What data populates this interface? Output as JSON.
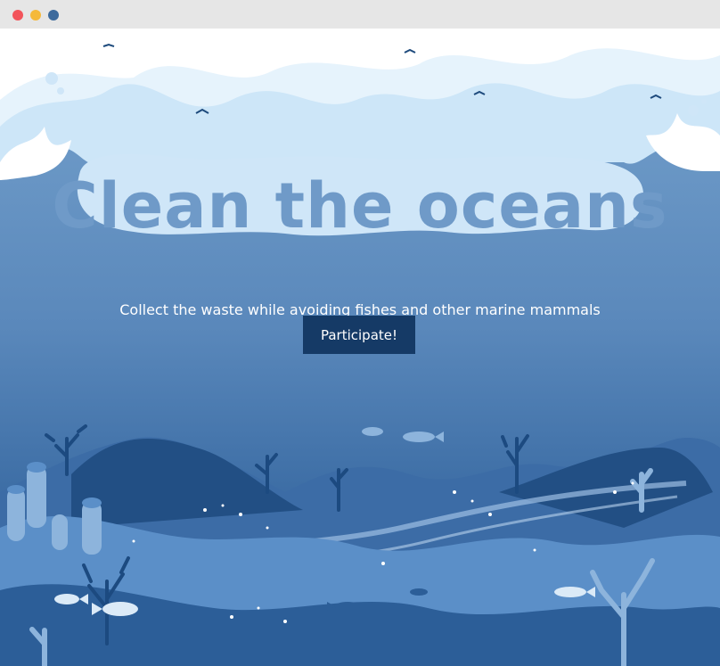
{
  "window": {
    "controls": [
      "close",
      "minimize",
      "maximize"
    ],
    "control_colors": {
      "close": "#f2545b",
      "minimize": "#f5b93a",
      "maximize": "#3d6a9c"
    }
  },
  "hero": {
    "title": "Clean the oceans",
    "subtitle": "Collect the waste while avoiding fishes and other marine mammals",
    "cta_label": "Participate!"
  },
  "colors": {
    "sky_top": "#6f9ac8",
    "deep_blue": "#27578c",
    "button": "#153a66",
    "foam": "#cfe6f8",
    "text_light": "#ffffff"
  }
}
